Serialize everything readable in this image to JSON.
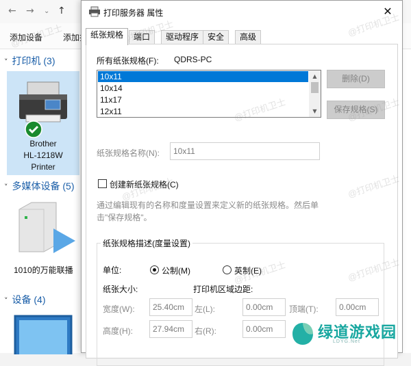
{
  "explorer": {
    "command_add_device": "添加设备",
    "command_add_printer": "添加打",
    "printers_header": "打印机 (3)",
    "printer_name_1": "Brother",
    "printer_name_2": "HL-1218W",
    "printer_name_3": "Printer",
    "media_header": "多媒体设备 (5)",
    "media_device": "1010的万能联播",
    "devices_header": "设备 (4)"
  },
  "dialog": {
    "title": "打印服务器 属性",
    "close": "✕",
    "tabs": [
      "纸张规格",
      "端口",
      "驱动程序",
      "安全",
      "高级"
    ],
    "all_forms_label": "所有纸张规格(F):",
    "server_name": "QDRS-PC",
    "forms": [
      "10x11",
      "10x14",
      "11x17",
      "12x11"
    ],
    "delete_button": "删除(D)",
    "save_button": "保存规格(S)",
    "form_name_label": "纸张规格名称(N):",
    "form_name_value": "10x11",
    "create_new_label": "创建新纸张规格(C)",
    "description_line1": "通过编辑现有的名称和度量设置来定义新的纸张规格。然后单",
    "description_line2": "击\"保存规格\"。",
    "measurements_title": "纸张规格描述(度量设置)",
    "units_label": "单位:",
    "metric_label": "公制(M)",
    "english_label": "英制(E)",
    "paper_size_label": "纸张大小:",
    "margins_label": "打印机区域边距:",
    "width_label": "宽度(W):",
    "width_value": "25.40cm",
    "height_label": "高度(H):",
    "height_value": "27.94cm",
    "left_label": "左(L):",
    "left_value": "0.00cm",
    "right_label": "右(R):",
    "right_value": "0.00cm",
    "top_label": "顶端(T):",
    "top_value": "0.00cm"
  },
  "watermark": "@打印机卫士",
  "logo": {
    "text": "绿道游戏园",
    "sub": "LDYG.Net"
  }
}
